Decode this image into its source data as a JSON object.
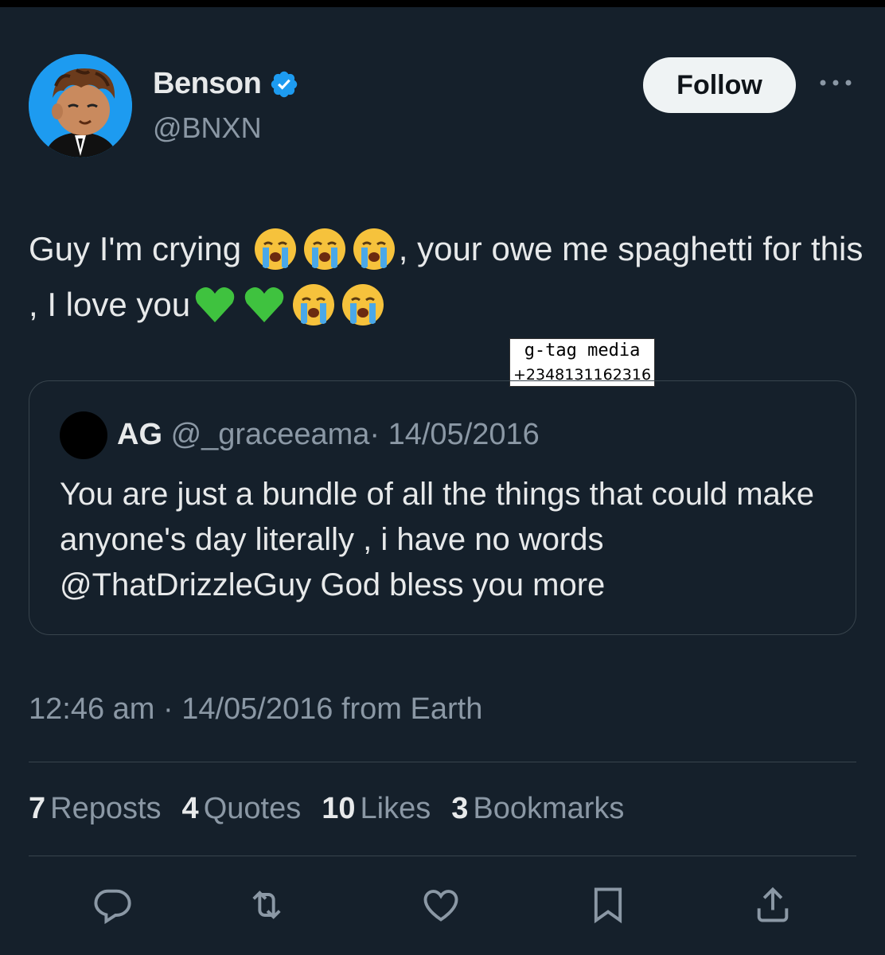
{
  "tweet": {
    "author_name": "Benson",
    "author_handle": "@BNXN",
    "follow_label": "Follow",
    "text_part1": "Guy I'm crying ",
    "text_part2": ", your owe me spaghetti for this , I love you",
    "emojis_after_part1": [
      "loudly-crying-face",
      "loudly-crying-face",
      "loudly-crying-face"
    ],
    "emojis_after_part2": [
      "green-heart",
      "green-heart",
      "loudly-crying-face",
      "loudly-crying-face"
    ],
    "timestamp": "12:46 am · 14/05/2016 from Earth"
  },
  "watermark": {
    "line1": "g-tag media",
    "line2": "+2348131162316"
  },
  "quote": {
    "name": "AG",
    "handle": "@_graceeama",
    "date": "· 14/05/2016",
    "text": "You are just a bundle of all the things that could make anyone's day literally , i have no words @ThatDrizzleGuy God bless you more"
  },
  "stats": [
    {
      "count": "7",
      "label": "Reposts"
    },
    {
      "count": "4",
      "label": "Quotes"
    },
    {
      "count": "10",
      "label": "Likes"
    },
    {
      "count": "3",
      "label": "Bookmarks"
    }
  ],
  "actions": [
    "reply-icon",
    "repost-icon",
    "like-icon",
    "bookmark-icon",
    "share-icon"
  ],
  "colors": {
    "background": "#15202b",
    "verified_blue": "#1d9bf0",
    "secondary_text": "#8b98a5",
    "border": "#38444d"
  }
}
